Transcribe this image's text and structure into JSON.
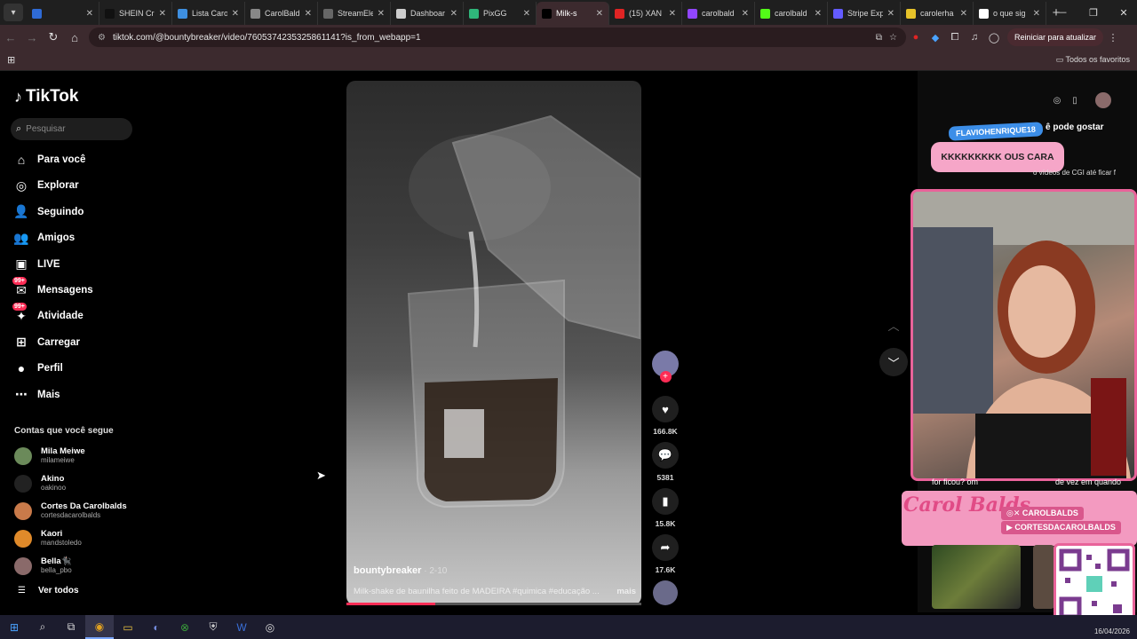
{
  "browser": {
    "tabs": [
      {
        "title": "",
        "color": "#2f6bd6"
      },
      {
        "title": "SHEIN Cr",
        "color": "#111111"
      },
      {
        "title": "Lista Caro",
        "color": "#3e8fe0"
      },
      {
        "title": "CarolBald",
        "color": "#888888"
      },
      {
        "title": "StreamEle",
        "color": "#666666"
      },
      {
        "title": "Dashboar",
        "color": "#cccccc"
      },
      {
        "title": "PixGG",
        "color": "#2fb57a"
      },
      {
        "title": "Milk-s",
        "color": "#000000",
        "active": true
      },
      {
        "title": "(15) XAN",
        "color": "#e02424"
      },
      {
        "title": "carolbald",
        "color": "#9146ff"
      },
      {
        "title": "carolbald",
        "color": "#53fc18"
      },
      {
        "title": "Stripe Exp",
        "color": "#635bff"
      },
      {
        "title": "carolerha",
        "color": "#e6c229"
      },
      {
        "title": "o que sig",
        "color": "#ffffff"
      }
    ],
    "url": "tiktok.com/@bountybreaker/video/7605374235325861141?is_from_webapp=1",
    "relaunch_label": "Reiniciar para atualizar",
    "bookmarks_label": "Todos os favoritos"
  },
  "sidebar": {
    "logo": "TikTok",
    "search_placeholder": "Pesquisar",
    "nav": [
      {
        "label": "Para você",
        "icon": "home-icon"
      },
      {
        "label": "Explorar",
        "icon": "compass-icon"
      },
      {
        "label": "Seguindo",
        "icon": "following-icon"
      },
      {
        "label": "Amigos",
        "icon": "friends-icon"
      },
      {
        "label": "LIVE",
        "icon": "live-icon"
      },
      {
        "label": "Mensagens",
        "icon": "messages-icon",
        "badge": "99+"
      },
      {
        "label": "Atividade",
        "icon": "activity-icon",
        "badge": "99+"
      },
      {
        "label": "Carregar",
        "icon": "upload-icon"
      },
      {
        "label": "Perfil",
        "icon": "profile-icon"
      },
      {
        "label": "Mais",
        "icon": "more-icon"
      }
    ],
    "following_title": "Contas que você segue",
    "accounts": [
      {
        "name": "Mila Meiwe",
        "handle": "milameiwe",
        "color": "#6b8a5a"
      },
      {
        "name": "Akino",
        "handle": "oakinoo",
        "color": "#222222"
      },
      {
        "name": "Cortes Da Carolbalds",
        "handle": "cortesdacarolbalds",
        "color": "#c97a4a"
      },
      {
        "name": "Kaori",
        "handle": "mandstoledo",
        "color": "#e08a2a"
      },
      {
        "name": "Bella🐈‍⬛",
        "handle": "bella_pbo",
        "color": "#8a6a6a"
      }
    ],
    "see_all": "Ver todos"
  },
  "video": {
    "author": "bountybreaker",
    "date": "2-10",
    "caption": "Milk-shake de baunilha feito de MADEIRA #quimica #educação ...",
    "more": "mais",
    "progress": 0.3,
    "likes": "166.8K",
    "comments": "5381",
    "saves": "15.8K",
    "shares": "17.6K"
  },
  "stream_overlay": {
    "chat_user": "FLAVIOHENRIQUE18",
    "chat_message": "KKKKKKKKK OUS CARA",
    "may_like": "ê pode gostar",
    "cgi_text": "o vídeos de CGI até ficar f",
    "sub_left": "for ficou? om",
    "sub_right": "de vez em quando",
    "signature": "Carol Balds",
    "social_1": "CAROLBALDS",
    "social_2": "CORTESDACAROLBALDS"
  },
  "taskbar": {
    "date": "16/04/2026"
  }
}
